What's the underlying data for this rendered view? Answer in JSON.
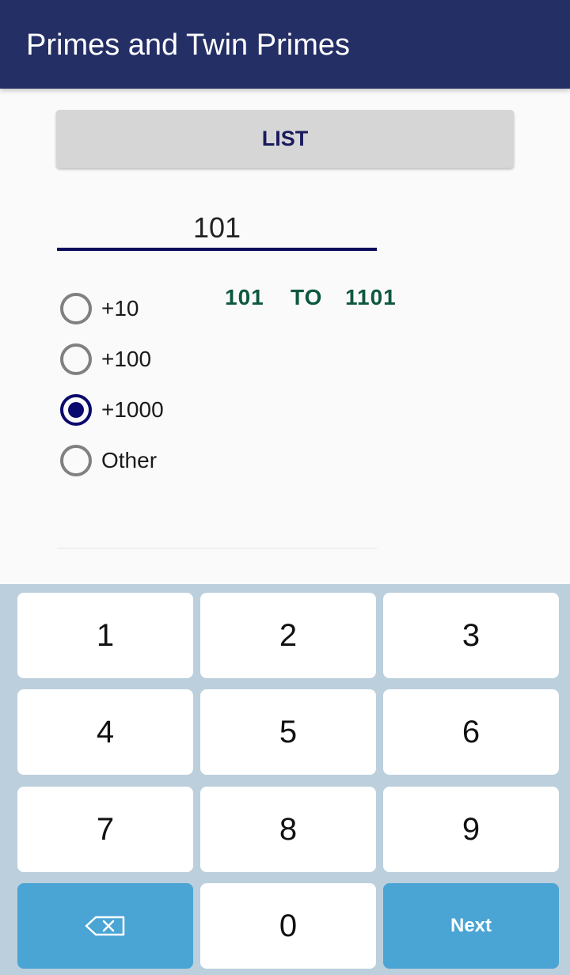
{
  "app": {
    "title": "Primes and Twin Primes"
  },
  "list_button": {
    "label": "LIST"
  },
  "number_input": {
    "value": "101"
  },
  "range": {
    "from": "101",
    "to_label": "TO",
    "to": "1101"
  },
  "increments": [
    {
      "label": "+10",
      "checked": false
    },
    {
      "label": "+100",
      "checked": false
    },
    {
      "label": "+1000",
      "checked": true
    },
    {
      "label": "Other",
      "checked": false
    }
  ],
  "keyboard": {
    "keys": [
      "1",
      "2",
      "3",
      "4",
      "5",
      "6",
      "7",
      "8",
      "9",
      "0"
    ],
    "backspace_icon": "backspace-icon",
    "next_label": "Next"
  },
  "colors": {
    "appbar": "#242f66",
    "accent": "#0a0a6e",
    "range_text": "#0e5740",
    "key_action": "#4aa4d4",
    "keyboard_bg": "#bccfdd"
  }
}
